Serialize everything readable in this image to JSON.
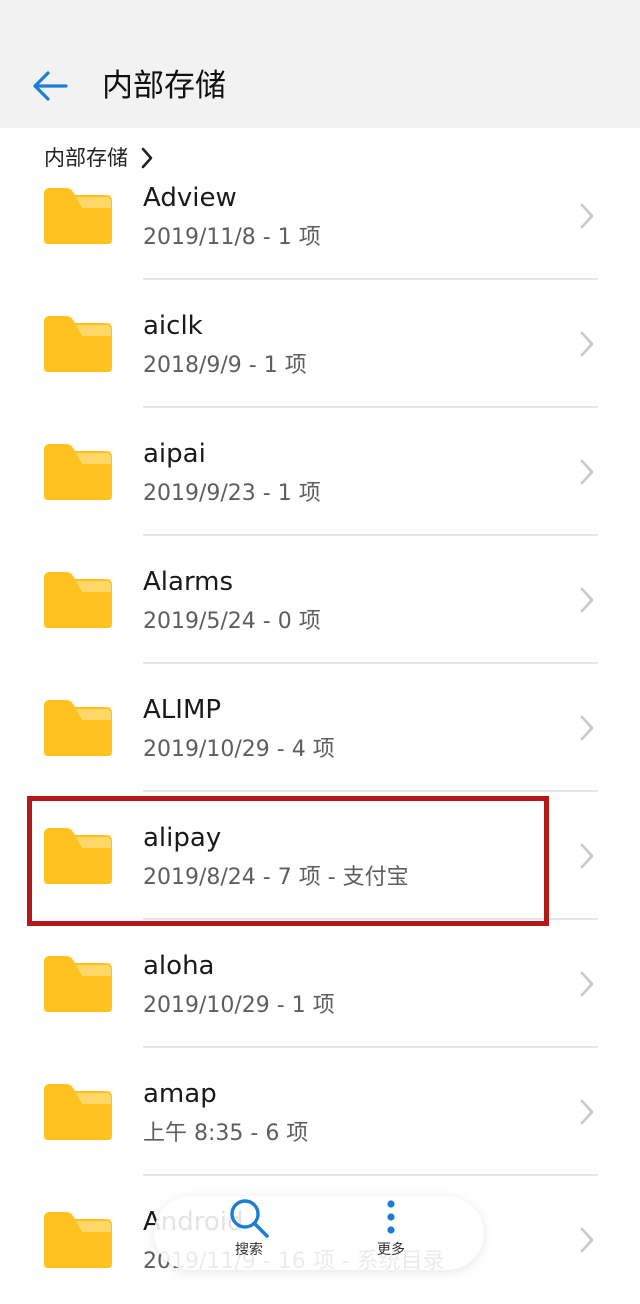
{
  "appbar": {
    "title": "内部存储"
  },
  "breadcrumb": {
    "label": "内部存储"
  },
  "folders": [
    {
      "name": "Adview",
      "meta": "2019/11/8 - 1 项"
    },
    {
      "name": "aiclk",
      "meta": "2018/9/9 - 1 项"
    },
    {
      "name": "aipai",
      "meta": "2019/9/23 - 1 项"
    },
    {
      "name": "Alarms",
      "meta": "2019/5/24 - 0 项"
    },
    {
      "name": "ALIMP",
      "meta": "2019/10/29 - 4 项"
    },
    {
      "name": "alipay",
      "meta": "2019/8/24 - 7 项 - 支付宝"
    },
    {
      "name": "aloha",
      "meta": "2019/10/29 - 1 项"
    },
    {
      "name": "amap",
      "meta": "上午 8:35 - 6 项"
    },
    {
      "name": "Android",
      "meta": "2019/11/9 - 16 项 - 系统目录"
    }
  ],
  "bottom_bar": {
    "search_label": "搜索",
    "more_label": "更多"
  },
  "colors": {
    "accent": "#1a7fd4",
    "folder": "#ffc21f",
    "folder_tab": "#ffd866",
    "highlight": "#b51818",
    "appbar_bg": "#f2f2f2"
  },
  "icons": {
    "back": "arrow-left-icon",
    "breadcrumb": "chevron-right-icon",
    "folder": "folder-icon",
    "row": "chevron-right-icon",
    "search": "search-icon",
    "more": "more-vertical-icon"
  }
}
